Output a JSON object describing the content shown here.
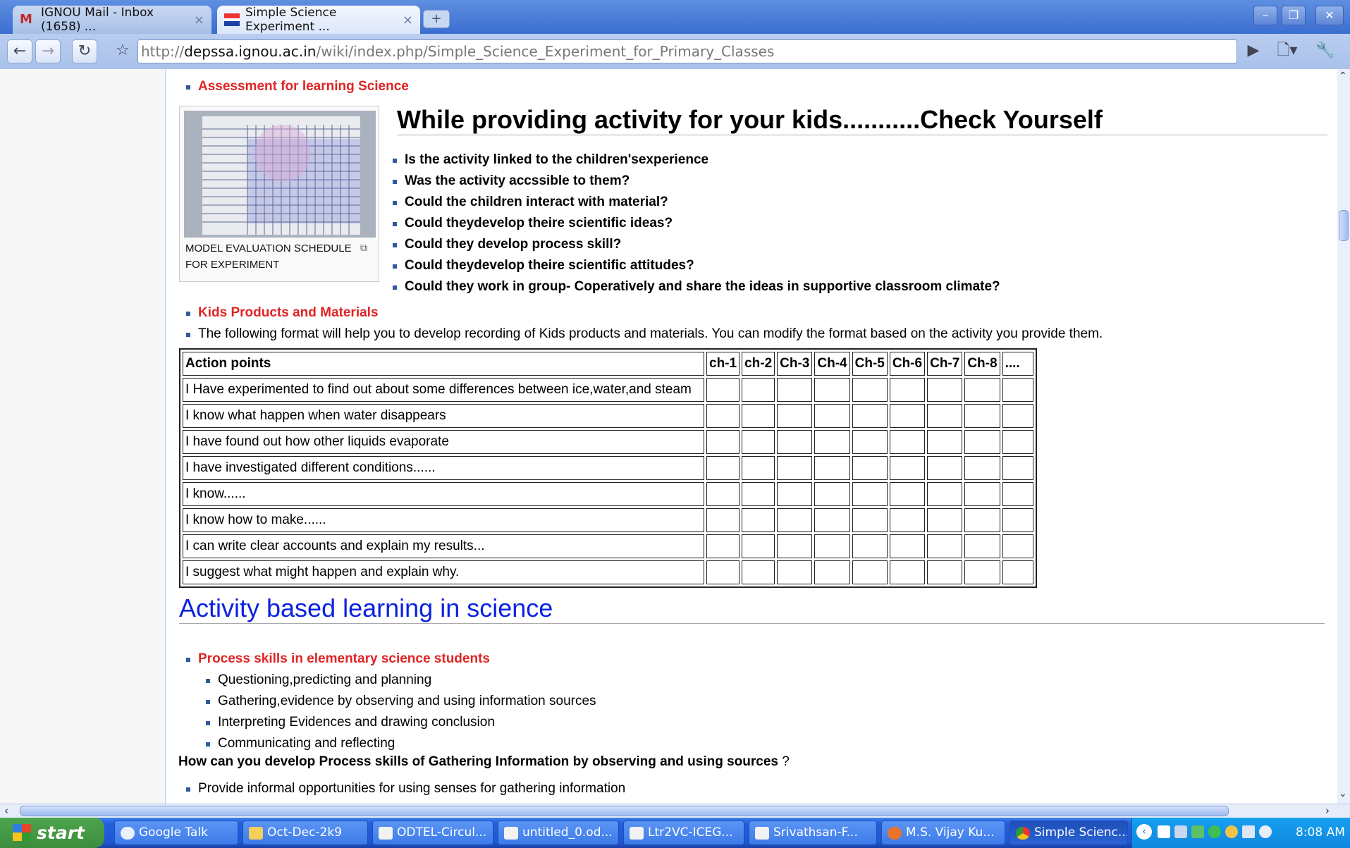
{
  "browser": {
    "tabs": [
      {
        "title": "IGNOU Mail - Inbox (1658) ..."
      },
      {
        "title": "Simple Science Experiment ..."
      }
    ],
    "url_prefix": "http://",
    "url_host": "depssa.ignou.ac.in",
    "url_path": "/wiki/index.php/Simple_Science_Experiment_for_Primary_Classes",
    "icons": [
      "back-icon",
      "forward-icon",
      "reload-icon",
      "star-icon",
      "play-icon",
      "page-menu-icon",
      "wrench-icon"
    ]
  },
  "page": {
    "assessment_link": "Assessment for learning Science",
    "figure_caption": "MODEL EVALUATION SCHEDULE FOR EXPERIMENT",
    "check_heading": "While providing activity for your kids...........Check Yourself",
    "check_items": [
      "Is the activity linked to the children'sexperience",
      "Was the activity accssible to them?",
      "Could the children interact with material?",
      "Could theydevelop theire scientific ideas?",
      "Could they develop process skill?",
      "Could theydevelop theire scientific attitudes?",
      "Could they work in group- Coperatively and share the ideas in supportive classroom climate?"
    ],
    "kids_link": "Kids Products and Materials",
    "format_note": "The following format will help you to develop recording of Kids products and materials. You can modify the format based on the activity you provide them.",
    "table": {
      "headers": [
        "Action points",
        "ch-1",
        "ch-2",
        "Ch-3",
        "Ch-4",
        "Ch-5",
        "Ch-6",
        "Ch-7",
        "Ch-8",
        "...."
      ],
      "rows": [
        "I Have experimented to find out about some differences between ice,water,and steam",
        "I know what happen when water disappears",
        "I have found out how other liquids evaporate",
        "I have investigated different conditions......",
        "I know......",
        "I know how to make......",
        "I can write clear accounts and explain my results...",
        "I suggest what might happen and explain why."
      ]
    },
    "abl_heading": "Activity based learning in science",
    "process_link": "Process skills in elementary science students",
    "process_items": [
      "Questioning,predicting and planning",
      "Gathering,evidence by observing and using information sources",
      "Interpreting Evidences and drawing conclusion",
      "Communicating and reflecting"
    ],
    "gather_question_bold": "How can you develop Process skills of Gathering Information by observing and using sources",
    "gather_question_mark": " ?",
    "last_item": "Provide informal opportunities for using senses for gathering information"
  },
  "taskbar": {
    "start_label": "start",
    "tasks": [
      "Google Talk",
      "Oct-Dec-2k9",
      "ODTEL-Circul...",
      "untitled_0.od...",
      "Ltr2VC-ICEG...",
      "Srivathsan-F...",
      "M.S. Vijay Ku...",
      "Simple Scienc..."
    ],
    "clock": "8:08 AM"
  },
  "colors": {
    "link_red": "#e02424",
    "heading_blue": "#0b22e0",
    "bullet": "#2e5a9e"
  }
}
